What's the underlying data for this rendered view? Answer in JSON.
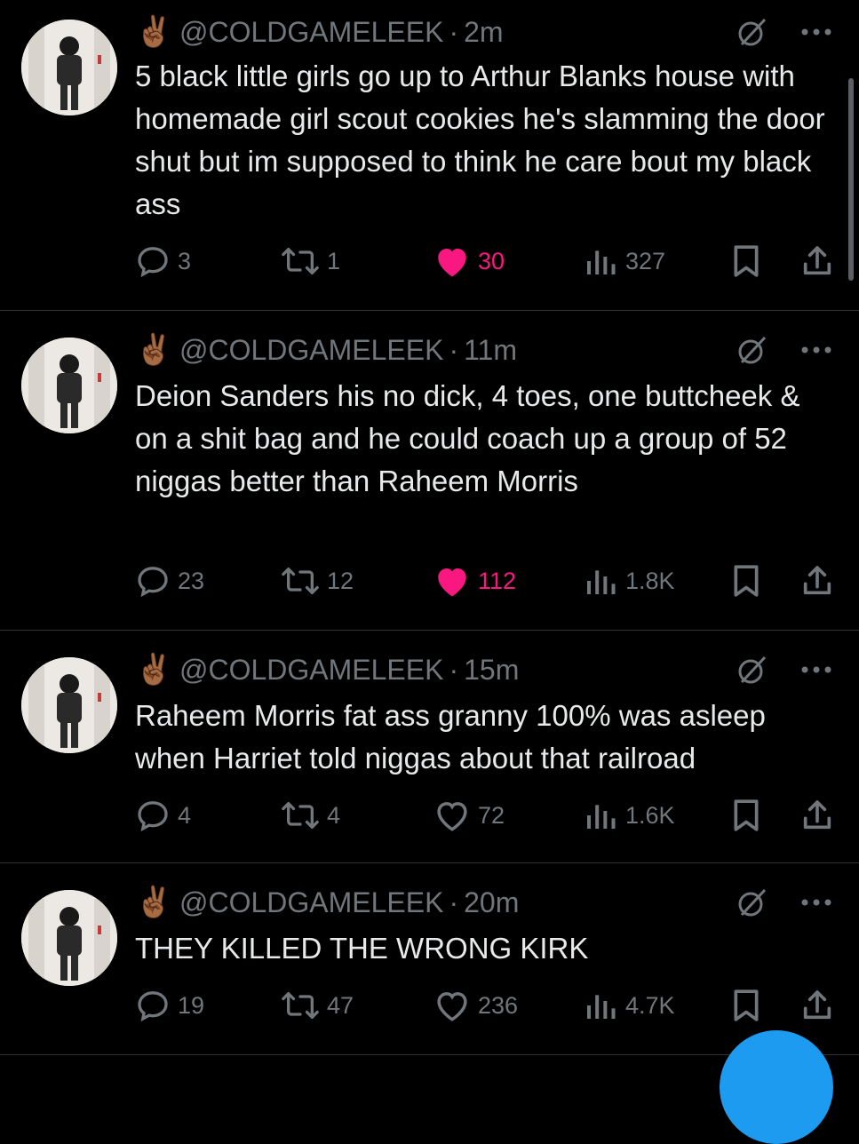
{
  "colors": {
    "background": "#000000",
    "text": "#e7e9ea",
    "muted": "#71767b",
    "like_active": "#f91880",
    "divider": "#2f3336",
    "accent": "#1d9bf0"
  },
  "tweets": [
    {
      "emoji": "✌🏾",
      "handle": "@COLDGAMELEEK",
      "separator": "·",
      "time": "2m",
      "text": "5 black little girls go up to Arthur Blanks house with homemade girl scout cookies he's slamming the door shut but im supposed to think he care bout my black ass",
      "replies": "3",
      "reposts": "1",
      "likes": "30",
      "liked": true,
      "views": "327"
    },
    {
      "emoji": "✌🏾",
      "handle": "@COLDGAMELEEK",
      "separator": "·",
      "time": "11m",
      "text": "Deion Sanders his no dick, 4 toes, one buttcheek & on a shit bag and he could coach up a group of 52 niggas better than Raheem Morris",
      "replies": "23",
      "reposts": "12",
      "likes": "112",
      "liked": true,
      "views": "1.8K"
    },
    {
      "emoji": "✌🏾",
      "handle": "@COLDGAMELEEK",
      "separator": "·",
      "time": "15m",
      "text": "Raheem Morris fat ass granny 100% was asleep when Harriet told niggas about that railroad",
      "replies": "4",
      "reposts": "4",
      "likes": "72",
      "liked": false,
      "views": "1.6K"
    },
    {
      "emoji": "✌🏾",
      "handle": "@COLDGAMELEEK",
      "separator": "·",
      "time": "20m",
      "text": "THEY KILLED THE WRONG KIRK",
      "replies": "19",
      "reposts": "47",
      "likes": "236",
      "liked": false,
      "views": "4.7K"
    }
  ],
  "icons": {
    "reply": "speech-bubble-icon",
    "repost": "repost-arrows-icon",
    "like": "heart-icon",
    "views": "bar-chart-icon",
    "bookmark": "bookmark-icon",
    "share": "share-upload-icon",
    "grok": "grok-slash-circle-icon",
    "more": "ellipsis-icon",
    "compose": "compose-fab"
  }
}
